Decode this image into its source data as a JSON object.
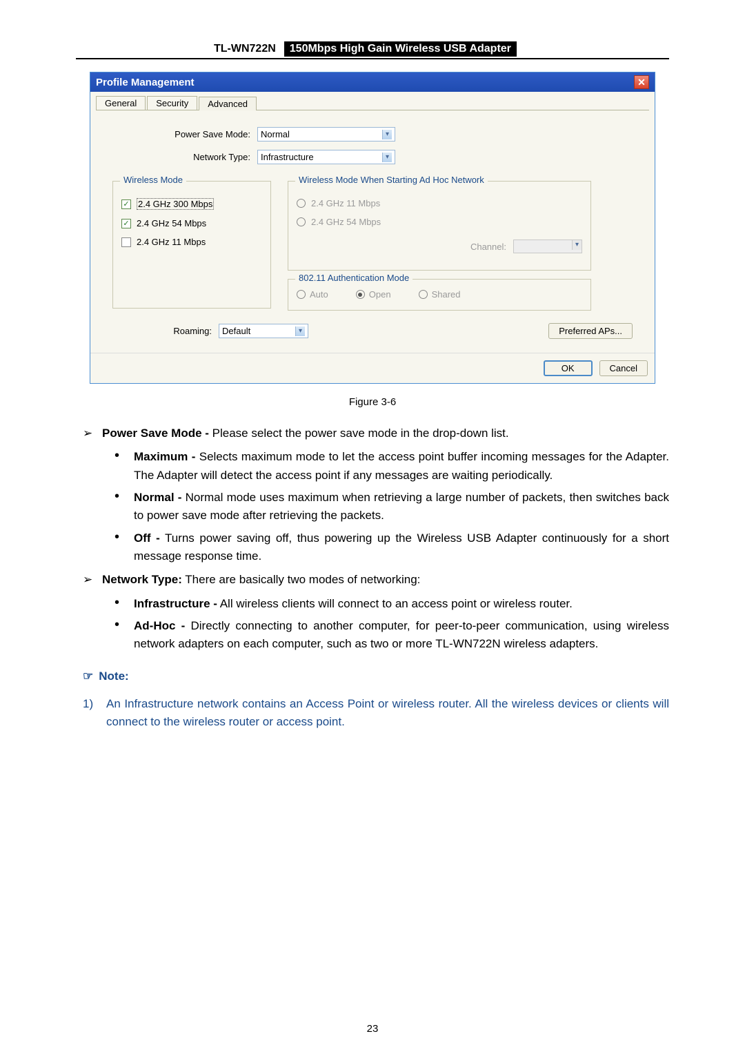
{
  "header": {
    "model": "TL-WN722N",
    "product": "150Mbps High Gain Wireless USB Adapter"
  },
  "dialog": {
    "title": "Profile Management",
    "tabs": {
      "t1": "General",
      "t2": "Security",
      "t3": "Advanced"
    },
    "power_save_label": "Power Save Mode:",
    "power_save_value": "Normal",
    "network_type_label": "Network Type:",
    "network_type_value": "Infrastructure",
    "wireless_mode_legend": "Wireless Mode",
    "wm1": "2.4 GHz 300 Mbps",
    "wm2": "2.4 GHz 54 Mbps",
    "wm3": "2.4 GHz 11 Mbps",
    "adhoc_legend": "Wireless Mode When Starting Ad Hoc Network",
    "ah1": "2.4 GHz 11 Mbps",
    "ah2": "2.4 GHz 54 Mbps",
    "channel_label": "Channel:",
    "auth_legend": "802.11 Authentication Mode",
    "auth_auto": "Auto",
    "auth_open": "Open",
    "auth_shared": "Shared",
    "roaming_label": "Roaming:",
    "roaming_value": "Default",
    "preferred_aps": "Preferred APs...",
    "ok": "OK",
    "cancel": "Cancel"
  },
  "figure_caption": "Figure 3-6",
  "body": {
    "psm_title": "Power Save Mode -",
    "psm_text": " Please select the power save mode in the drop-down list.",
    "max_title": "Maximum -",
    "max_text": " Selects maximum mode to let the access point buffer incoming messages for the Adapter. The Adapter will detect the access point if any messages are waiting periodically.",
    "norm_title": "Normal -",
    "norm_text": " Normal mode uses maximum when retrieving a large number of packets, then switches back to power save mode after retrieving the packets.",
    "off_title": "Off -",
    "off_text": " Turns power saving off, thus powering up the Wireless USB Adapter continuously for a short message response time.",
    "nt_title": "Network Type:",
    "nt_text": " There are basically two modes of networking:",
    "infra_title": "Infrastructure -",
    "infra_text": " All wireless clients will connect to an access point or wireless router.",
    "adhoc_title": "Ad-Hoc -",
    "adhoc_text": " Directly connecting to another computer, for peer-to-peer communication, using wireless network adapters on each computer, such as two or more TL-WN722N wireless adapters.",
    "note_label": "Note:",
    "note1_num": "1)",
    "note1_text": "An Infrastructure network contains an Access Point or wireless router. All the wireless devices or clients will connect to the wireless router or access point."
  },
  "page_number": "23"
}
